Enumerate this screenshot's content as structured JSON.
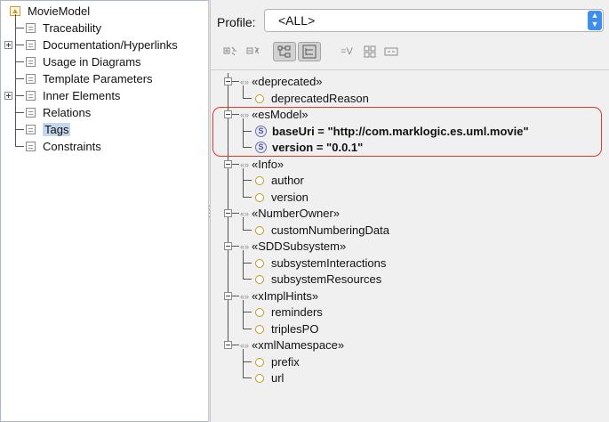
{
  "nav_tree": {
    "root_label": "MovieModel",
    "items": [
      {
        "label": "Traceability",
        "expandable": false
      },
      {
        "label": "Documentation/Hyperlinks",
        "expandable": true
      },
      {
        "label": "Usage in Diagrams",
        "expandable": false
      },
      {
        "label": "Template Parameters",
        "expandable": false
      },
      {
        "label": "Inner Elements",
        "expandable": true
      },
      {
        "label": "Relations",
        "expandable": false
      },
      {
        "label": "Tags",
        "expandable": false,
        "selected": true
      },
      {
        "label": "Constraints",
        "expandable": false
      }
    ]
  },
  "profile": {
    "label": "Profile:",
    "selected": "<ALL>"
  },
  "toolbar": {
    "buttons": [
      "expand-all",
      "collapse-all",
      "tree-view",
      "flat-view",
      "filter-values",
      "show-grid",
      "show-list"
    ],
    "filter_label": "=V"
  },
  "tags_tree": {
    "stereotypes": [
      {
        "name": "«deprecated»",
        "glyph": "«»",
        "properties": [
          {
            "name": "deprecatedReason",
            "type": "prop"
          }
        ]
      },
      {
        "name": "«esModel»",
        "glyph": "«»",
        "highlighted": true,
        "properties": [
          {
            "name": "baseUri = \"http://com.marklogic.es.uml.movie\"",
            "type": "tag"
          },
          {
            "name": "version = \"0.0.1\"",
            "type": "tag"
          }
        ]
      },
      {
        "name": "«Info»",
        "glyph": "«»",
        "properties": [
          {
            "name": "author",
            "type": "prop"
          },
          {
            "name": "version",
            "type": "prop"
          }
        ]
      },
      {
        "name": "«NumberOwner»",
        "glyph": "«»",
        "properties": [
          {
            "name": "customNumberingData",
            "type": "prop"
          }
        ]
      },
      {
        "name": "«SDDSubsystem»",
        "glyph": "«»",
        "properties": [
          {
            "name": "subsystemInteractions",
            "type": "prop"
          },
          {
            "name": "subsystemResources",
            "type": "prop"
          }
        ]
      },
      {
        "name": "«xImplHints»",
        "glyph": "«»",
        "properties": [
          {
            "name": "reminders",
            "type": "prop"
          },
          {
            "name": "triplesPO",
            "type": "prop"
          }
        ]
      },
      {
        "name": "«xmlNamespace»",
        "glyph": "«»",
        "properties": [
          {
            "name": "prefix",
            "type": "prop"
          },
          {
            "name": "url",
            "type": "prop"
          }
        ]
      }
    ],
    "tag_icon_letter": "S"
  },
  "colors": {
    "accent": "#3d8ef1",
    "highlight_border": "#e0392b",
    "selection": "#c5d7ef"
  }
}
